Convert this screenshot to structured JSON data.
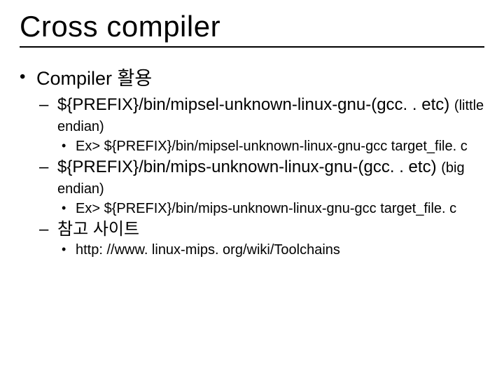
{
  "title": "Cross compiler",
  "b1": "Compiler 활용",
  "b2a_main": "${PREFIX}/bin/mipsel-unknown-linux-gnu-(gcc. . etc)",
  "b2a_note": "(little endian)",
  "b3a": "Ex> ${PREFIX}/bin/mipsel-unknown-linux-gnu-gcc target_file. c",
  "b2b_main": "${PREFIX}/bin/mips-unknown-linux-gnu-(gcc. . etc)",
  "b2b_note": "(big endian)",
  "b3b": "Ex> ${PREFIX}/bin/mips-unknown-linux-gnu-gcc target_file. c",
  "b2c": "참고 사이트",
  "b3c": "http: //www. linux-mips. org/wiki/Toolchains"
}
